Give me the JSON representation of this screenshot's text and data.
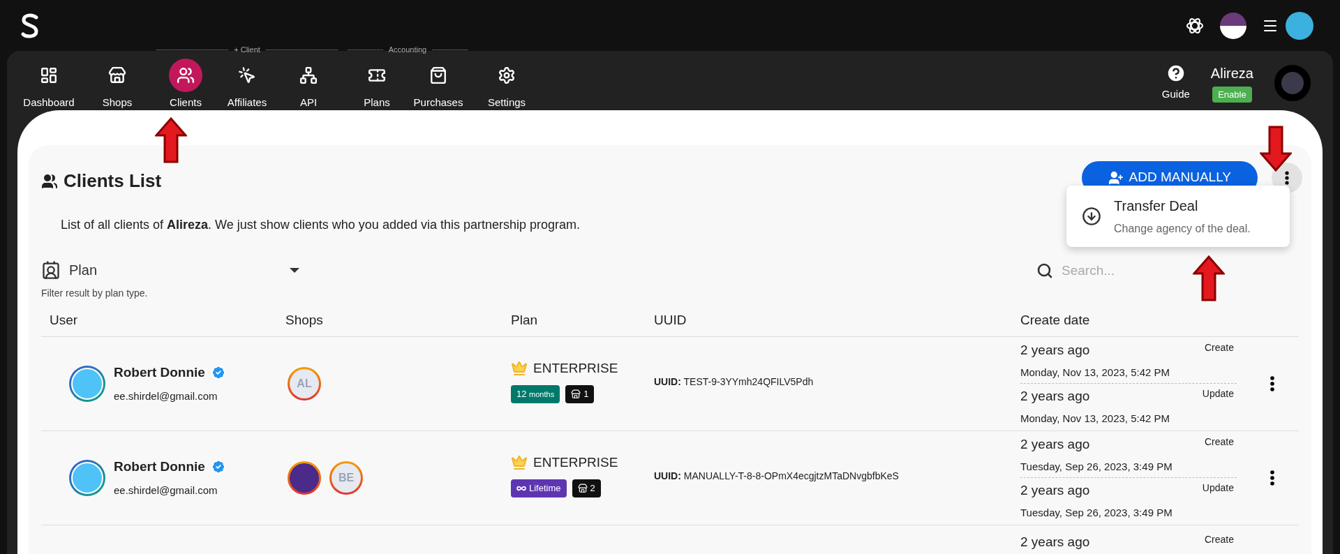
{
  "nav": [
    {
      "kind": "item",
      "label": "Dashboard",
      "selected": false
    },
    {
      "kind": "item",
      "label": "Shops",
      "selected": false
    },
    {
      "kind": "group",
      "title": "+ Client",
      "items": [
        {
          "label": "Clients",
          "selected": true
        },
        {
          "label": "Affiliates",
          "selected": false
        },
        {
          "label": "API",
          "selected": false
        }
      ]
    },
    {
      "kind": "group",
      "title": "Accounting",
      "items": [
        {
          "label": "Plans",
          "selected": false
        },
        {
          "label": "Purchases",
          "selected": false
        }
      ]
    },
    {
      "kind": "item",
      "label": "Settings",
      "selected": false
    }
  ],
  "guide": "Guide",
  "profile": {
    "name": "Alireza",
    "badge": "Enable"
  },
  "page": {
    "title": "Clients List",
    "description": "List of all clients of **Alireza**. We just show clients who you added via this partnership program.",
    "add_button": "ADD MANUALLY"
  },
  "menu": {
    "items": [
      {
        "title": "Transfer Deal",
        "subtitle": "Change agency of the deal."
      }
    ]
  },
  "filter": {
    "value": "Plan",
    "hint": "Filter result by plan type."
  },
  "search": {
    "placeholder": "Search..."
  },
  "table": {
    "columns": [
      "User",
      "Shops",
      "Plan",
      "UUID",
      "Create date"
    ],
    "rows": [
      {
        "name": "Robert Donnie",
        "verified": true,
        "email": "ee.shirdel@gmail.com",
        "shops": [
          {
            "kind": "initials",
            "label": "AL"
          }
        ],
        "plan": "ENTERPRISE",
        "duration": {
          "kind": "months",
          "value": "12",
          "unit": "months"
        },
        "shop_count": "1",
        "uuid_label": "UUID:",
        "uuid": "TEST-9-3YYmh24QFILV5Pdh",
        "dates": [
          {
            "ago": "2 years ago",
            "date": "Monday, Nov 13, 2023, 5:42 PM",
            "label": "Create"
          },
          {
            "ago": "2 years ago",
            "date": "Monday, Nov 13, 2023, 5:42 PM",
            "label": "Update"
          }
        ]
      },
      {
        "name": "Robert Donnie",
        "verified": true,
        "email": "ee.shirdel@gmail.com",
        "shops": [
          {
            "kind": "logo"
          },
          {
            "kind": "initials",
            "label": "BE"
          }
        ],
        "plan": "ENTERPRISE",
        "duration": {
          "kind": "lifetime",
          "unit": "Lifetime"
        },
        "shop_count": "2",
        "uuid_label": "UUID:",
        "uuid": "MANUALLY-T-8-8-OPmX4ecgjtzMTaDNvgbfbKeS",
        "dates": [
          {
            "ago": "2 years ago",
            "date": "Tuesday, Sep 26, 2023, 3:49 PM",
            "label": "Create"
          },
          {
            "ago": "2 years ago",
            "date": "Tuesday, Sep 26, 2023, 3:49 PM",
            "label": "Update"
          }
        ]
      },
      {
        "dates": [
          {
            "ago": "2 years ago",
            "label": "Create"
          }
        ]
      }
    ]
  }
}
